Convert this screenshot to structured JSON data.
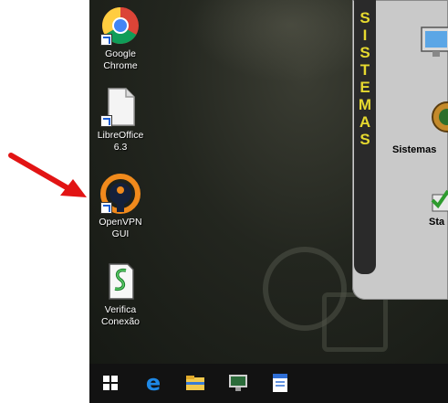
{
  "desktop_icons": [
    {
      "label": "Google\nChrome",
      "icon": "chrome-icon"
    },
    {
      "label": "LibreOffice\n6.3",
      "icon": "libreoffice-icon"
    },
    {
      "label": "OpenVPN\nGUI",
      "icon": "openvpn-icon"
    },
    {
      "label": "Verifica\nConexão",
      "icon": "script-icon"
    }
  ],
  "sistemas_panel": {
    "letters": [
      "S",
      "I",
      "S",
      "T",
      "E",
      "M",
      "A",
      "S"
    ],
    "app_label": "Sistemas",
    "app2_label": "Sta"
  },
  "taskbar": {
    "items": [
      "windows-start-icon",
      "edge-icon",
      "file-explorer-icon",
      "monitor-app-icon",
      "document-app-icon"
    ]
  },
  "colors": {
    "arrow": "#e21414",
    "rail_text": "#e6d92f"
  }
}
